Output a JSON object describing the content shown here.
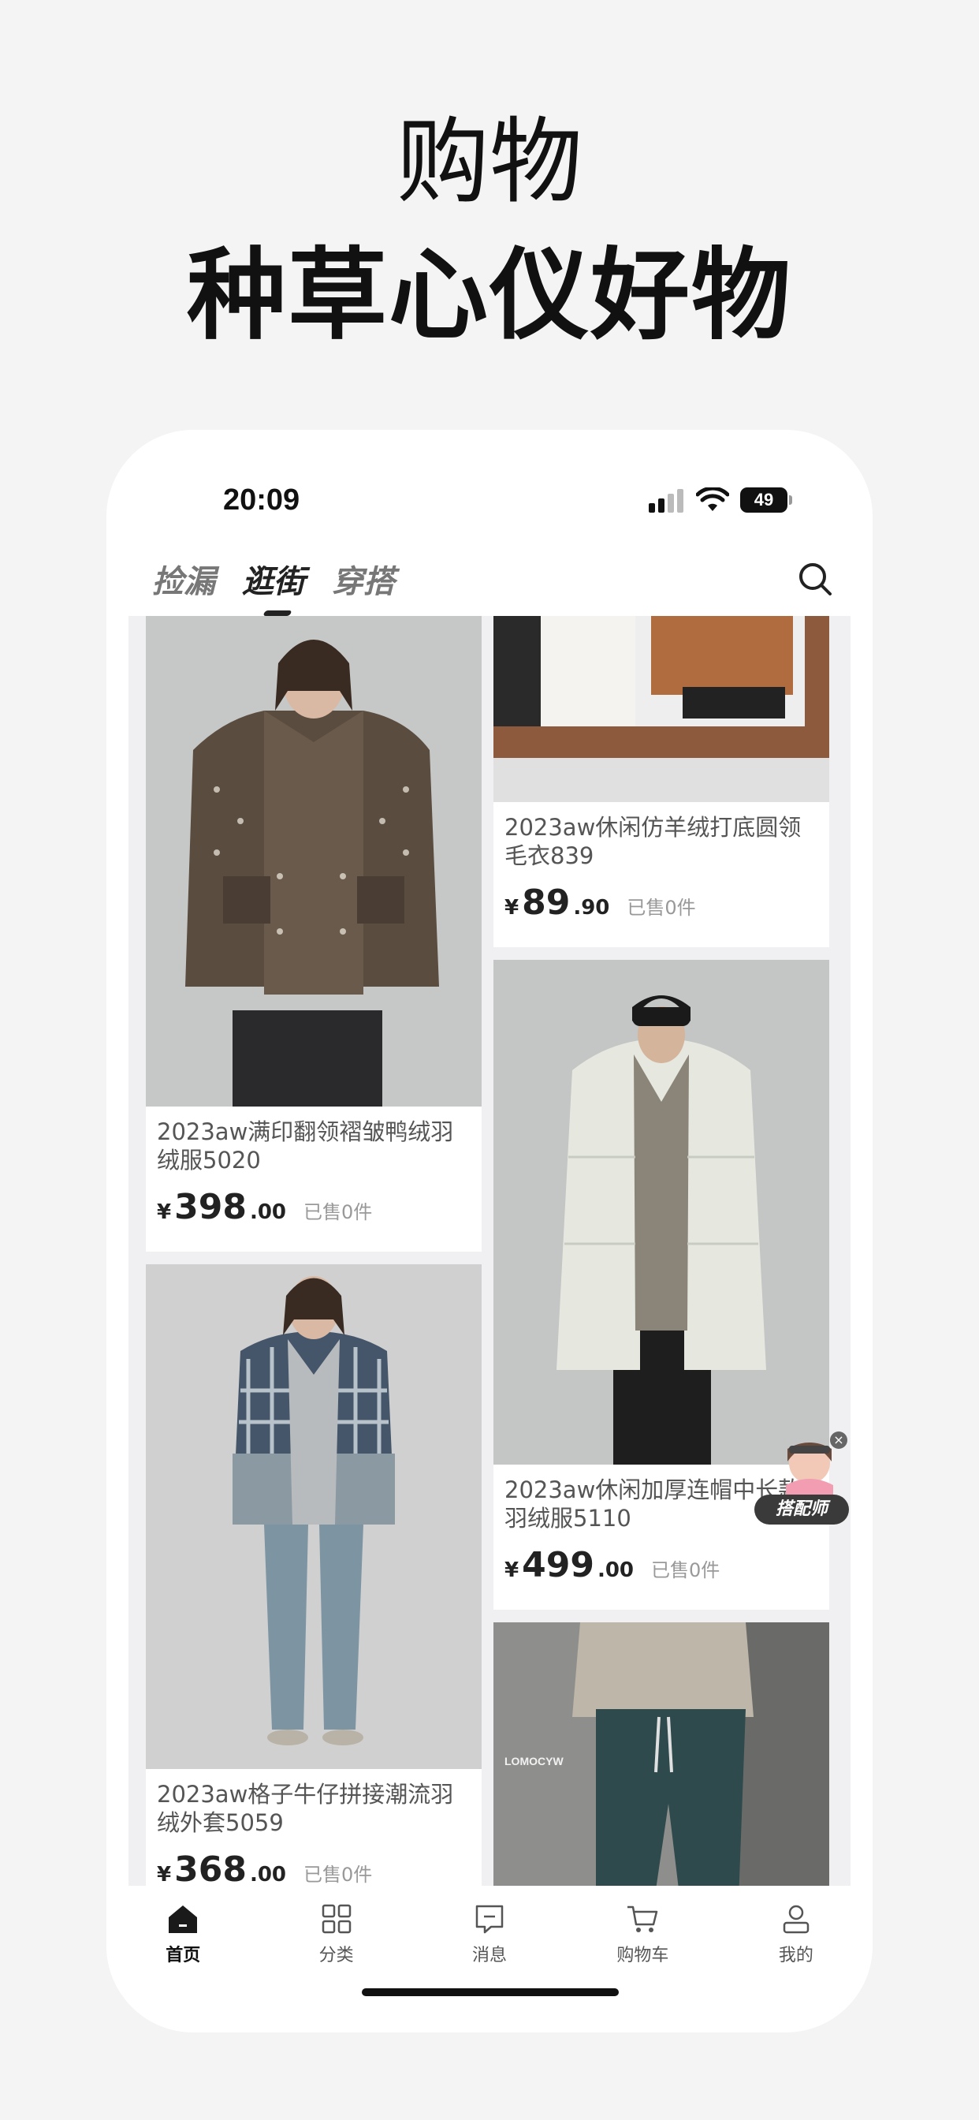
{
  "promo": {
    "line1": "购物",
    "line2": "种草心仪好物"
  },
  "status_bar": {
    "time": "20:09",
    "battery": "49"
  },
  "top_tabs": [
    {
      "label": "捡漏",
      "active": false
    },
    {
      "label": "逛街",
      "active": true
    },
    {
      "label": "穿搭",
      "active": false
    }
  ],
  "search": {
    "icon": "search-icon"
  },
  "products_left": [
    {
      "title": "2023aw满印翻领褶皱鸭绒羽绒服5020",
      "yen": "¥",
      "price_int": "398",
      "price_dec": ".00",
      "sold": "已售0件"
    },
    {
      "title": "2023aw格子牛仔拼接潮流羽绒外套5059",
      "yen": "¥",
      "price_int": "368",
      "price_dec": ".00",
      "sold": "已售0件"
    }
  ],
  "products_right": [
    {
      "title": "2023aw休闲仿羊绒打底圆领毛衣839",
      "yen": "¥",
      "price_int": "89",
      "price_dec": ".90",
      "sold": "已售0件"
    },
    {
      "title": "2023aw休闲加厚连帽中长款羽绒服5110",
      "yen": "¥",
      "price_int": "499",
      "price_dec": ".00",
      "sold": "已售0件"
    },
    {
      "title": "",
      "yen": "",
      "price_int": "",
      "price_dec": "",
      "sold": "",
      "brand_mark": "LOMOCYW"
    }
  ],
  "float_badge": {
    "label": "搭配师"
  },
  "bottom_nav": [
    {
      "label": "首页",
      "icon": "home-icon",
      "active": true
    },
    {
      "label": "分类",
      "icon": "grid-icon",
      "active": false
    },
    {
      "label": "消息",
      "icon": "message-icon",
      "active": false
    },
    {
      "label": "购物车",
      "icon": "cart-icon",
      "active": false
    },
    {
      "label": "我的",
      "icon": "user-icon",
      "active": false
    }
  ]
}
